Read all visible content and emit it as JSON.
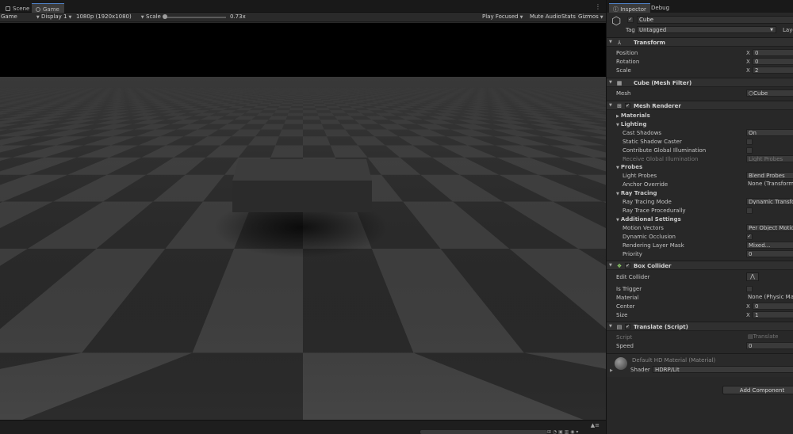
{
  "left": {
    "tabs": [
      {
        "label": "Scene"
      },
      {
        "label": "Game"
      }
    ],
    "toolbar": {
      "view_mode": "Game",
      "display": "Display 1",
      "resolution": "1080p (1920x1080)",
      "scale_label": "Scale",
      "scale_value": "0.73x",
      "play_focused": "Play Focused",
      "mute_audio": "Mute Audio",
      "stats": "Stats",
      "gizmos": "Gizmos"
    }
  },
  "inspector": {
    "tabs": [
      {
        "label": "Inspector"
      },
      {
        "label": "Debug"
      }
    ],
    "object_name": "Cube",
    "tag_label": "Tag",
    "tag_value": "Untagged",
    "layer_label": "Layer",
    "transform": {
      "title": "Transform",
      "position_label": "Position",
      "position_x": "0",
      "rotation_label": "Rotation",
      "rotation_x": "0",
      "scale_label": "Scale",
      "scale_x": "2"
    },
    "mesh_filter": {
      "title": "Cube (Mesh Filter)",
      "mesh_label": "Mesh",
      "mesh_value": "Cube"
    },
    "mesh_renderer": {
      "title": "Mesh Renderer",
      "materials": "Materials",
      "lighting": "Lighting",
      "cast_shadows_label": "Cast Shadows",
      "cast_shadows_value": "On",
      "static_shadow_label": "Static Shadow Caster",
      "contribute_gi_label": "Contribute Global Illumination",
      "receive_gi_label": "Receive Global Illumination",
      "receive_gi_value": "Light Probes",
      "probes": "Probes",
      "light_probes_label": "Light Probes",
      "light_probes_value": "Blend Probes",
      "anchor_label": "Anchor Override",
      "anchor_value": "None (Transform)",
      "ray_tracing": "Ray Tracing",
      "rt_mode_label": "Ray Tracing Mode",
      "rt_mode_value": "Dynamic Transform",
      "rt_proc_label": "Ray Trace Procedurally",
      "additional": "Additional Settings",
      "motion_label": "Motion Vectors",
      "motion_value": "Per Object Motion",
      "dyn_occ_label": "Dynamic Occlusion",
      "layer_mask_label": "Rendering Layer Mask",
      "layer_mask_value": "Mixed...",
      "priority_label": "Priority",
      "priority_value": "0"
    },
    "box_collider": {
      "title": "Box Collider",
      "edit_label": "Edit Collider",
      "trigger_label": "Is Trigger",
      "material_label": "Material",
      "material_value": "None (Physic Material)",
      "center_label": "Center",
      "center_x": "0",
      "size_label": "Size",
      "size_x": "1"
    },
    "translate": {
      "title": "Translate (Script)",
      "script_label": "Script",
      "script_value": "Translate",
      "speed_label": "Speed",
      "speed_value": "0"
    },
    "material": {
      "name": "Default HD Material (Material)",
      "shader_label": "Shader",
      "shader_value": "HDRP/Lit"
    },
    "add_component": "Add Component",
    "axis_x": "X"
  }
}
